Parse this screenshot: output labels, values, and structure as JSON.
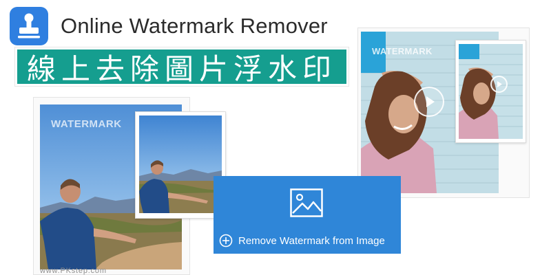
{
  "header": {
    "app_title": "Online Watermark Remover",
    "app_icon": "stamp-icon",
    "chinese_title": "線上去除圖片浮水印"
  },
  "left_card": {
    "watermark_text": "WATERMARK"
  },
  "right_card": {
    "watermark_text": "WATERMARK"
  },
  "remove_panel": {
    "icon": "image-icon",
    "action_icon": "plus-circle-icon",
    "label": "Remove Watermark from Image"
  },
  "footer": {
    "url": "www.PKstep.com"
  },
  "colors": {
    "accent_blue": "#2f86d8",
    "app_icon_blue": "#2f7fe0",
    "banner_teal": "#159e8f",
    "title_text": "#2b2b2b"
  }
}
